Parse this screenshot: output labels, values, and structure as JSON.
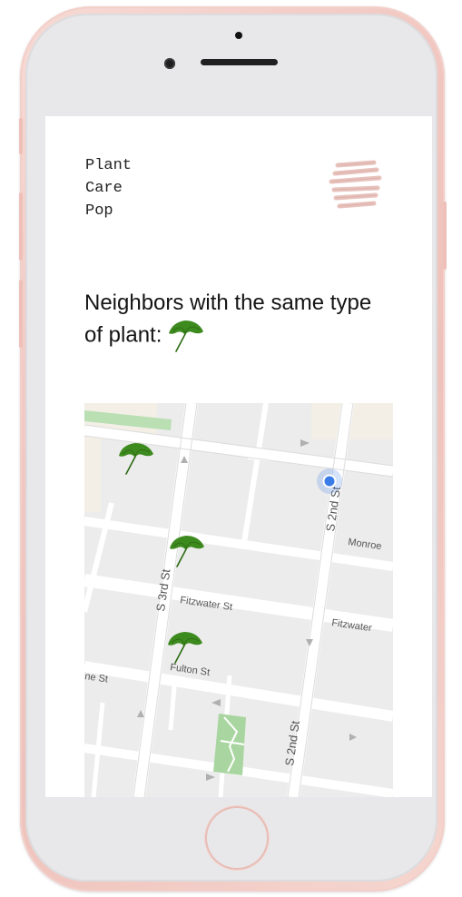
{
  "app": {
    "logo_lines": [
      "Plant",
      "Care",
      "Pop"
    ],
    "headline": "Neighbors with the same type of plant:"
  },
  "icons": {
    "menu": "hamburger-menu-icon",
    "plant": "ginkgo-leaf-icon",
    "user_location": "location-dot-icon"
  },
  "colors": {
    "phone_frame": "#f0c6bf",
    "leaf_green": "#3d8a1f",
    "map_bg": "#eeeeee",
    "road": "#ffffff",
    "park": "#a9d6a0",
    "location_blue": "#3b7de8"
  },
  "map": {
    "streets": [
      "S 2nd St",
      "S 3rd St",
      "Fitzwater St",
      "Monroe",
      "Fulton St",
      "S 2nd St",
      "Fitzwater",
      "ne St"
    ],
    "markers": [
      "neighbor-plant",
      "neighbor-plant",
      "neighbor-plant"
    ]
  }
}
